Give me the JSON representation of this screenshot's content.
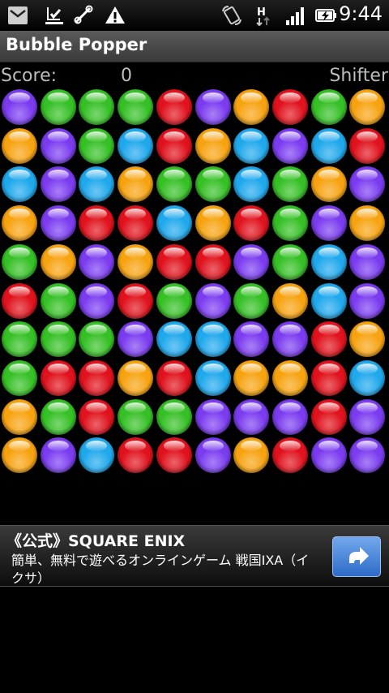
{
  "status_bar": {
    "icons": [
      "mail-icon",
      "download-complete-icon",
      "usb-debug-icon",
      "warning-icon",
      "screen-rotate-icon",
      "hspa-data-icon",
      "signal-icon",
      "battery-charging-icon"
    ],
    "time": "9:44"
  },
  "app": {
    "title": "Bubble Popper"
  },
  "score_row": {
    "label": "Score:",
    "value": "0",
    "mode": "Shifter"
  },
  "board": {
    "rows": 10,
    "cols": 10,
    "colors": {
      "P": "#7b3cf0",
      "G": "#35c025",
      "R": "#e0121d",
      "O": "#f7a310",
      "B": "#1fa8ec"
    },
    "grid": [
      [
        "P",
        "G",
        "G",
        "G",
        "R",
        "P",
        "O",
        "R",
        "G",
        "O"
      ],
      [
        "O",
        "P",
        "G",
        "B",
        "R",
        "O",
        "B",
        "P",
        "B",
        "R"
      ],
      [
        "B",
        "P",
        "B",
        "O",
        "G",
        "G",
        "B",
        "G",
        "O",
        "P"
      ],
      [
        "O",
        "P",
        "R",
        "R",
        "B",
        "O",
        "R",
        "G",
        "P",
        "O"
      ],
      [
        "G",
        "O",
        "P",
        "O",
        "R",
        "R",
        "P",
        "G",
        "B",
        "P"
      ],
      [
        "R",
        "G",
        "P",
        "R",
        "G",
        "P",
        "G",
        "O",
        "B",
        "P"
      ],
      [
        "G",
        "G",
        "G",
        "P",
        "B",
        "B",
        "P",
        "P",
        "R",
        "O"
      ],
      [
        "G",
        "R",
        "R",
        "O",
        "R",
        "B",
        "O",
        "O",
        "R",
        "B"
      ],
      [
        "O",
        "G",
        "R",
        "G",
        "G",
        "P",
        "P",
        "P",
        "R",
        "P"
      ],
      [
        "O",
        "P",
        "B",
        "R",
        "R",
        "P",
        "O",
        "R",
        "P",
        "P"
      ]
    ]
  },
  "ad": {
    "title": "《公式》SQUARE ENIX",
    "body": "簡単、無料で遊べるオンラインゲーム 戦国IXA（イクサ）",
    "action_icon": "share-arrow-icon"
  }
}
